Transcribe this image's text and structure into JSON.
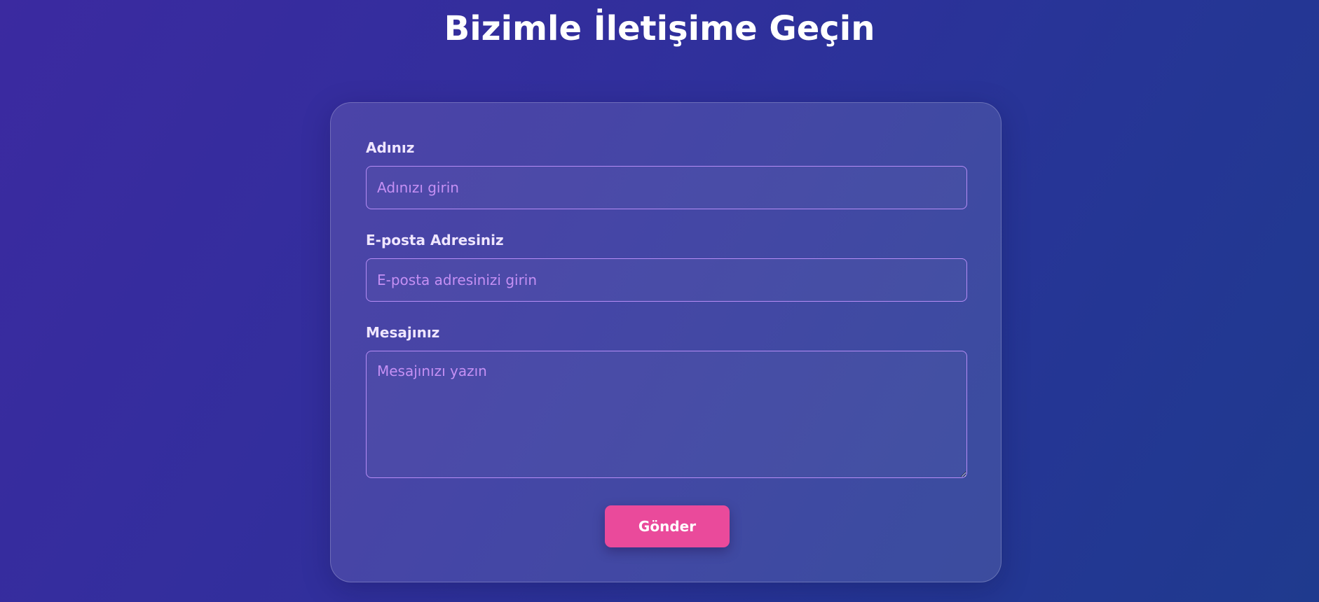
{
  "page": {
    "title": "Bizimle İletişime Geçin"
  },
  "form": {
    "name": {
      "label": "Adınız",
      "placeholder": "Adınızı girin",
      "value": ""
    },
    "email": {
      "label": "E-posta Adresiniz",
      "placeholder": "E-posta adresinizi girin",
      "value": ""
    },
    "message": {
      "label": "Mesajınız",
      "placeholder": "Mesajınızı yazın",
      "value": ""
    },
    "submit_label": "Gönder"
  },
  "colors": {
    "background_start": "#3b2aa0",
    "background_end": "#1f3a8e",
    "input_border": "#b68cf5",
    "placeholder": "#c590f4",
    "button": "#ea4a9b",
    "text": "#ffffff"
  }
}
